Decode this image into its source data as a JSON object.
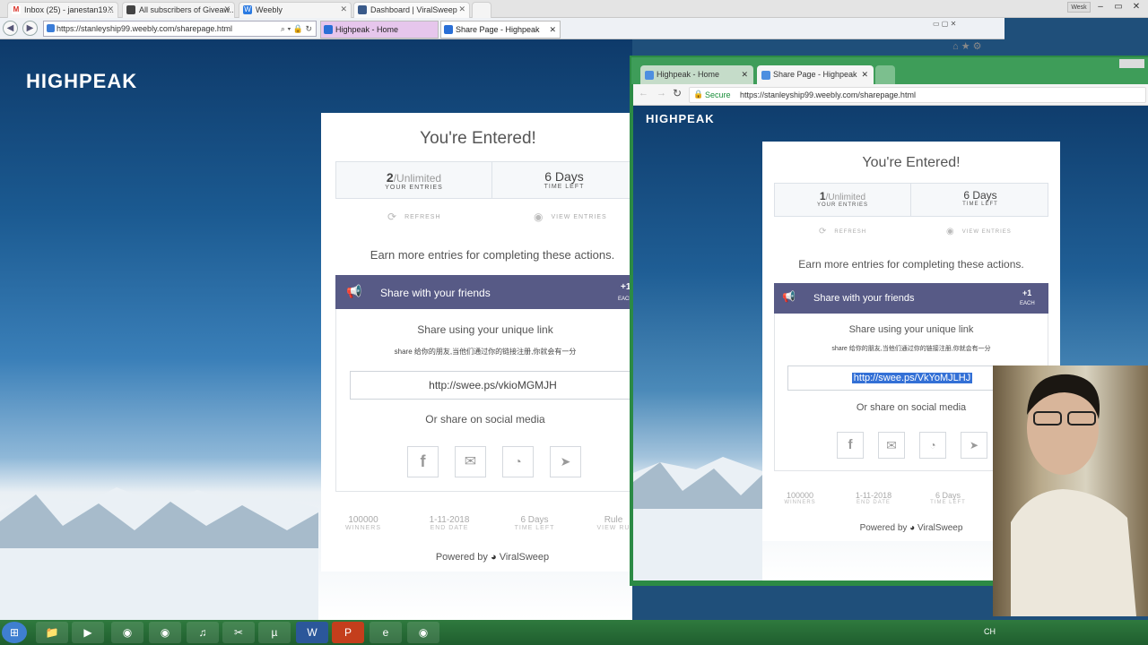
{
  "top_tabs": [
    {
      "label": "Inbox (25) - janestan19...",
      "icon": "gmail-icon",
      "color": "#d93025"
    },
    {
      "label": "All subscribers of Giveaw...",
      "icon": "giveaway-icon",
      "color": "#555555"
    },
    {
      "label": "Weebly",
      "icon": "weebly-icon",
      "color": "#2a7ae2"
    },
    {
      "label": "Dashboard | ViralSweep",
      "icon": "viralsweep-icon",
      "color": "#3a5a8a"
    }
  ],
  "user_chip": "Wesk",
  "ie": {
    "url": "https://stanleyship99.weebly.com/sharepage.html",
    "tabs": [
      {
        "label": "Highpeak - Home"
      },
      {
        "label": "Share Page - Highpeak"
      }
    ]
  },
  "left": {
    "logo": "HIGHPEAK",
    "card": {
      "title": "You're Entered!",
      "entries_value": "2",
      "entries_suffix": "/Unlimited",
      "entries_label": "YOUR ENTRIES",
      "time_value": "6 Days",
      "time_label": "TIME LEFT",
      "refresh": "REFRESH",
      "view_entries": "VIEW ENTRIES",
      "earn_text": "Earn more entries for completing these actions.",
      "share_title": "Share with your friends",
      "share_bonus": "+1",
      "share_bonus_label": "EACH",
      "share_unique": "Share using your unique link",
      "share_desc": "share 给你的朋友,当他们通过你的链接注册,你就会有一分",
      "link": "http://swee.ps/vkioMGMJH",
      "or_social": "Or share on social media",
      "footer": [
        {
          "value": "100000",
          "label": "WINNERS"
        },
        {
          "value": "1-11-2018",
          "label": "END DATE"
        },
        {
          "value": "6 Days",
          "label": "TIME LEFT"
        },
        {
          "value": "Rule",
          "label": "VIEW RU"
        }
      ],
      "powered_by": "Powered by",
      "brand": "ViralSweep"
    }
  },
  "right": {
    "tabs": [
      {
        "label": "Highpeak - Home"
      },
      {
        "label": "Share Page - Highpeak"
      }
    ],
    "secure": "Secure",
    "url": "https://stanleyship99.weebly.com/sharepage.html",
    "logo": "HIGHPEAK",
    "card": {
      "title": "You're Entered!",
      "entries_value": "1",
      "entries_suffix": "/Unlimited",
      "entries_label": "YOUR ENTRIES",
      "time_value": "6 Days",
      "time_label": "TIME LEFT",
      "refresh": "REFRESH",
      "view_entries": "VIEW ENTRIES",
      "earn_text": "Earn more entries for completing these actions.",
      "share_title": "Share with your friends",
      "share_bonus": "+1",
      "share_bonus_label": "EACH",
      "share_unique": "Share using your unique link",
      "share_desc": "share 给你的朋友,当他们通过你的链接注册,你就会有一分",
      "link": "http://swee.ps/VkYoMJLHJ",
      "or_social": "Or share on social media",
      "footer": [
        {
          "value": "100000",
          "label": "WINNERS"
        },
        {
          "value": "1-11-2018",
          "label": "END DATE"
        },
        {
          "value": "6 Days",
          "label": "TIME LEFT"
        }
      ],
      "powered_by": "Powered by",
      "brand": "ViralSweep"
    }
  },
  "tray": {
    "lang": "CH"
  },
  "colors": {
    "share_header": "#575a86",
    "chrome_frame": "#2c8a45",
    "selection": "#3370d6"
  }
}
